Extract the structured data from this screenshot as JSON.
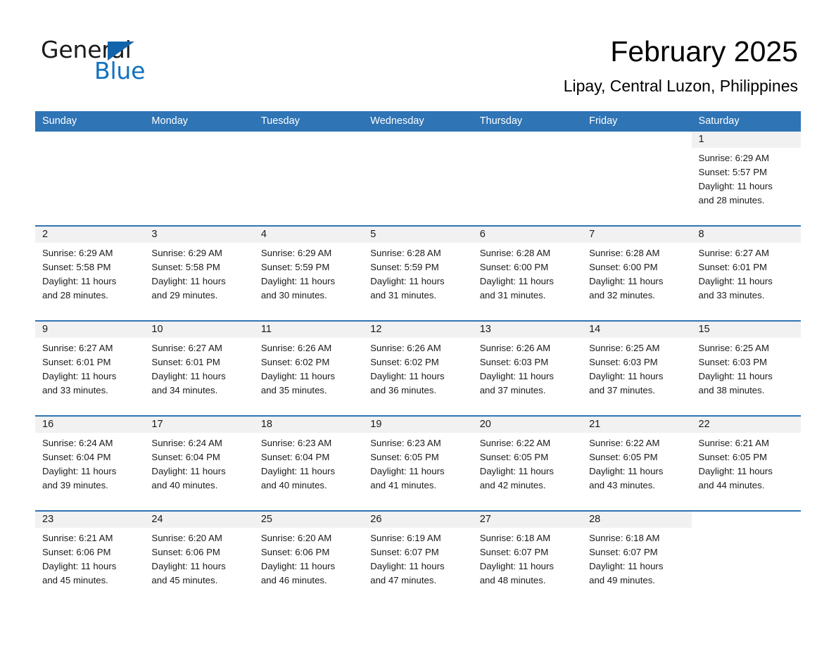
{
  "brand": {
    "line1": "General",
    "line2": "Blue",
    "triangle_color": "#1164ab",
    "blue_text_color": "#1271c1"
  },
  "header": {
    "month_title": "February 2025",
    "location": "Lipay, Central Luzon, Philippines"
  },
  "theme": {
    "header_blue": "#2f74b5",
    "daynum_band": "#f1f1f1",
    "cell_background": "#ffffff"
  },
  "calendar": {
    "weekdays": [
      "Sunday",
      "Monday",
      "Tuesday",
      "Wednesday",
      "Thursday",
      "Friday",
      "Saturday"
    ],
    "weeks": [
      [
        {
          "day": "",
          "lines": []
        },
        {
          "day": "",
          "lines": []
        },
        {
          "day": "",
          "lines": []
        },
        {
          "day": "",
          "lines": []
        },
        {
          "day": "",
          "lines": []
        },
        {
          "day": "",
          "lines": []
        },
        {
          "day": "1",
          "lines": [
            "Sunrise: 6:29 AM",
            "Sunset: 5:57 PM",
            "Daylight: 11 hours",
            "and 28 minutes."
          ]
        }
      ],
      [
        {
          "day": "2",
          "lines": [
            "Sunrise: 6:29 AM",
            "Sunset: 5:58 PM",
            "Daylight: 11 hours",
            "and 28 minutes."
          ]
        },
        {
          "day": "3",
          "lines": [
            "Sunrise: 6:29 AM",
            "Sunset: 5:58 PM",
            "Daylight: 11 hours",
            "and 29 minutes."
          ]
        },
        {
          "day": "4",
          "lines": [
            "Sunrise: 6:29 AM",
            "Sunset: 5:59 PM",
            "Daylight: 11 hours",
            "and 30 minutes."
          ]
        },
        {
          "day": "5",
          "lines": [
            "Sunrise: 6:28 AM",
            "Sunset: 5:59 PM",
            "Daylight: 11 hours",
            "and 31 minutes."
          ]
        },
        {
          "day": "6",
          "lines": [
            "Sunrise: 6:28 AM",
            "Sunset: 6:00 PM",
            "Daylight: 11 hours",
            "and 31 minutes."
          ]
        },
        {
          "day": "7",
          "lines": [
            "Sunrise: 6:28 AM",
            "Sunset: 6:00 PM",
            "Daylight: 11 hours",
            "and 32 minutes."
          ]
        },
        {
          "day": "8",
          "lines": [
            "Sunrise: 6:27 AM",
            "Sunset: 6:01 PM",
            "Daylight: 11 hours",
            "and 33 minutes."
          ]
        }
      ],
      [
        {
          "day": "9",
          "lines": [
            "Sunrise: 6:27 AM",
            "Sunset: 6:01 PM",
            "Daylight: 11 hours",
            "and 33 minutes."
          ]
        },
        {
          "day": "10",
          "lines": [
            "Sunrise: 6:27 AM",
            "Sunset: 6:01 PM",
            "Daylight: 11 hours",
            "and 34 minutes."
          ]
        },
        {
          "day": "11",
          "lines": [
            "Sunrise: 6:26 AM",
            "Sunset: 6:02 PM",
            "Daylight: 11 hours",
            "and 35 minutes."
          ]
        },
        {
          "day": "12",
          "lines": [
            "Sunrise: 6:26 AM",
            "Sunset: 6:02 PM",
            "Daylight: 11 hours",
            "and 36 minutes."
          ]
        },
        {
          "day": "13",
          "lines": [
            "Sunrise: 6:26 AM",
            "Sunset: 6:03 PM",
            "Daylight: 11 hours",
            "and 37 minutes."
          ]
        },
        {
          "day": "14",
          "lines": [
            "Sunrise: 6:25 AM",
            "Sunset: 6:03 PM",
            "Daylight: 11 hours",
            "and 37 minutes."
          ]
        },
        {
          "day": "15",
          "lines": [
            "Sunrise: 6:25 AM",
            "Sunset: 6:03 PM",
            "Daylight: 11 hours",
            "and 38 minutes."
          ]
        }
      ],
      [
        {
          "day": "16",
          "lines": [
            "Sunrise: 6:24 AM",
            "Sunset: 6:04 PM",
            "Daylight: 11 hours",
            "and 39 minutes."
          ]
        },
        {
          "day": "17",
          "lines": [
            "Sunrise: 6:24 AM",
            "Sunset: 6:04 PM",
            "Daylight: 11 hours",
            "and 40 minutes."
          ]
        },
        {
          "day": "18",
          "lines": [
            "Sunrise: 6:23 AM",
            "Sunset: 6:04 PM",
            "Daylight: 11 hours",
            "and 40 minutes."
          ]
        },
        {
          "day": "19",
          "lines": [
            "Sunrise: 6:23 AM",
            "Sunset: 6:05 PM",
            "Daylight: 11 hours",
            "and 41 minutes."
          ]
        },
        {
          "day": "20",
          "lines": [
            "Sunrise: 6:22 AM",
            "Sunset: 6:05 PM",
            "Daylight: 11 hours",
            "and 42 minutes."
          ]
        },
        {
          "day": "21",
          "lines": [
            "Sunrise: 6:22 AM",
            "Sunset: 6:05 PM",
            "Daylight: 11 hours",
            "and 43 minutes."
          ]
        },
        {
          "day": "22",
          "lines": [
            "Sunrise: 6:21 AM",
            "Sunset: 6:05 PM",
            "Daylight: 11 hours",
            "and 44 minutes."
          ]
        }
      ],
      [
        {
          "day": "23",
          "lines": [
            "Sunrise: 6:21 AM",
            "Sunset: 6:06 PM",
            "Daylight: 11 hours",
            "and 45 minutes."
          ]
        },
        {
          "day": "24",
          "lines": [
            "Sunrise: 6:20 AM",
            "Sunset: 6:06 PM",
            "Daylight: 11 hours",
            "and 45 minutes."
          ]
        },
        {
          "day": "25",
          "lines": [
            "Sunrise: 6:20 AM",
            "Sunset: 6:06 PM",
            "Daylight: 11 hours",
            "and 46 minutes."
          ]
        },
        {
          "day": "26",
          "lines": [
            "Sunrise: 6:19 AM",
            "Sunset: 6:07 PM",
            "Daylight: 11 hours",
            "and 47 minutes."
          ]
        },
        {
          "day": "27",
          "lines": [
            "Sunrise: 6:18 AM",
            "Sunset: 6:07 PM",
            "Daylight: 11 hours",
            "and 48 minutes."
          ]
        },
        {
          "day": "28",
          "lines": [
            "Sunrise: 6:18 AM",
            "Sunset: 6:07 PM",
            "Daylight: 11 hours",
            "and 49 minutes."
          ]
        },
        {
          "day": "",
          "lines": []
        }
      ]
    ]
  }
}
